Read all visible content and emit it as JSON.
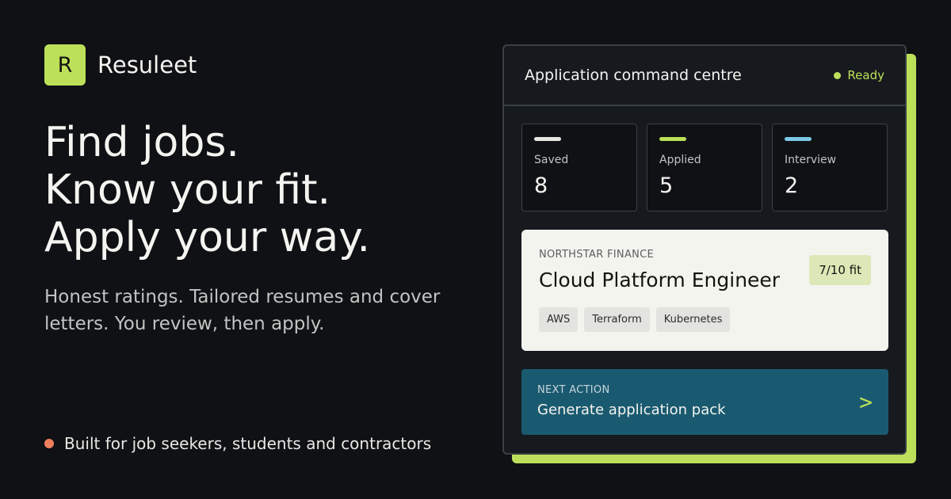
{
  "brand": {
    "logo_letter": "R",
    "name": "Resuleet"
  },
  "headline": {
    "lines": [
      "Find jobs.",
      "Know your fit.",
      "Apply your way."
    ]
  },
  "subtext": "Honest ratings. Tailored resumes and cover letters. You review, then apply.",
  "footnote": {
    "text": "Built for job seekers, students and contractors",
    "dot_color": "#f07f5d"
  },
  "panel": {
    "title": "Application command centre",
    "status": "Ready",
    "stats": [
      {
        "label": "Saved",
        "value": "8",
        "color": "#e6e6e2"
      },
      {
        "label": "Applied",
        "value": "5",
        "color": "#bde05a"
      },
      {
        "label": "Interview",
        "value": "2",
        "color": "#7ac8e4"
      }
    ],
    "job": {
      "company": "NORTHSTAR FINANCE",
      "title": "Cloud Platform Engineer",
      "fit": "7/10 fit",
      "tags": [
        "AWS",
        "Terraform",
        "Kubernetes"
      ]
    },
    "next_action": {
      "label": "NEXT ACTION",
      "title": "Generate application pack",
      "arrow": ">"
    }
  },
  "colors": {
    "accent": "#bde05a",
    "background": "#0f1114",
    "action": "#1a5a70"
  },
  "icons": {
    "status": "status-dot-icon",
    "arrow": "chevron-right-icon"
  }
}
